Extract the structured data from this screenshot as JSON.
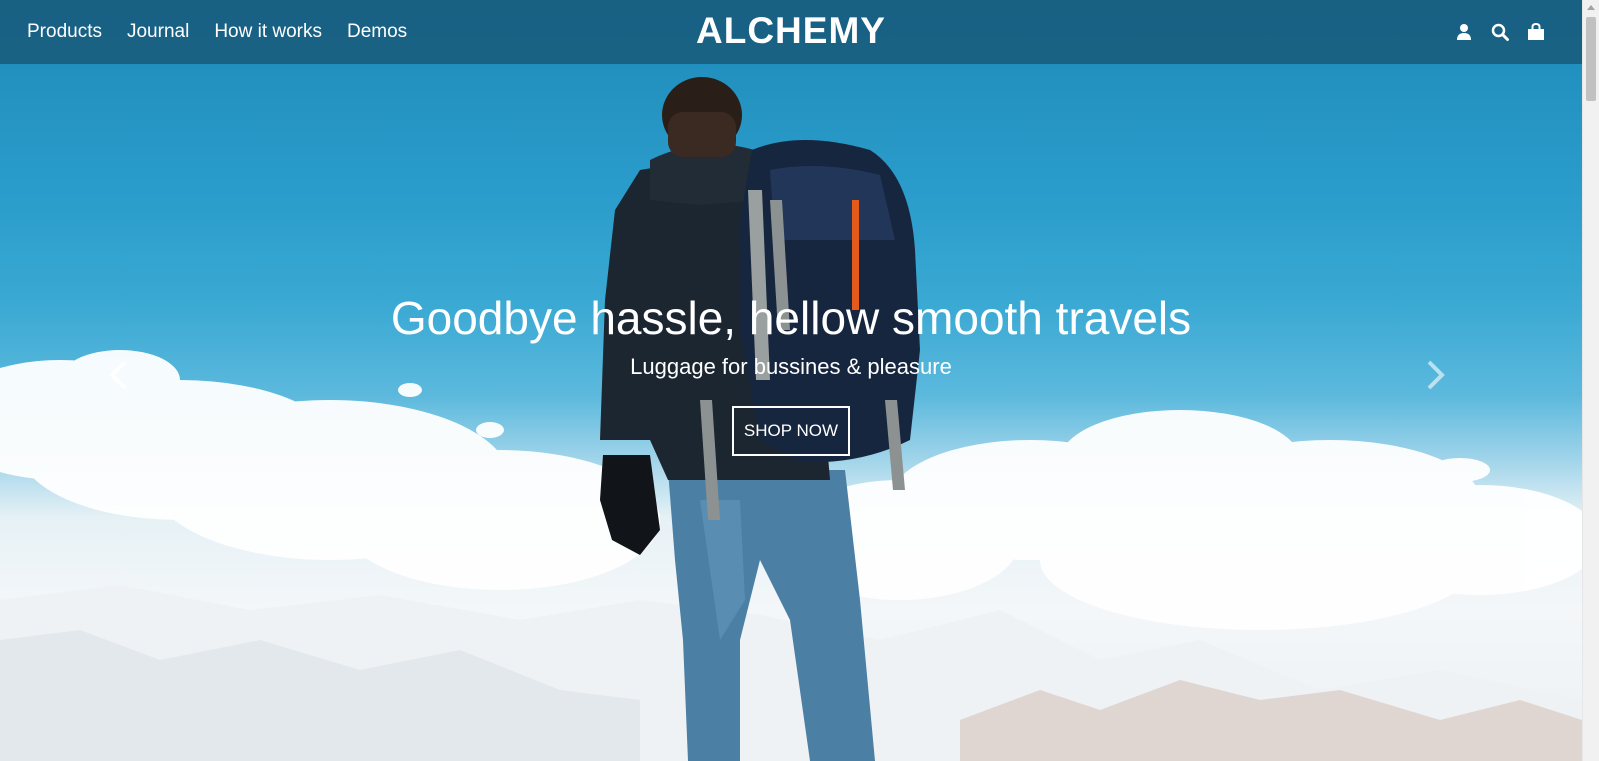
{
  "header": {
    "nav": [
      {
        "label": "Products"
      },
      {
        "label": "Journal"
      },
      {
        "label": "How it works"
      },
      {
        "label": "Demos"
      }
    ],
    "logo": "ALCHEMY",
    "icons": [
      "user-icon",
      "search-icon",
      "shopping-bag-icon"
    ]
  },
  "hero": {
    "title": "Goodbye hassle, hellow smooth travels",
    "subtitle": "Luggage for bussines & pleasure",
    "cta_label": "SHOP NOW",
    "prev_icon": "chevron-left-icon",
    "next_icon": "chevron-right-icon"
  },
  "colors": {
    "header_bg": "#185878",
    "sky_top": "#1e8ab8",
    "sky_mid": "#3aa9d3",
    "snow": "#f4f7f9",
    "text": "#ffffff"
  }
}
